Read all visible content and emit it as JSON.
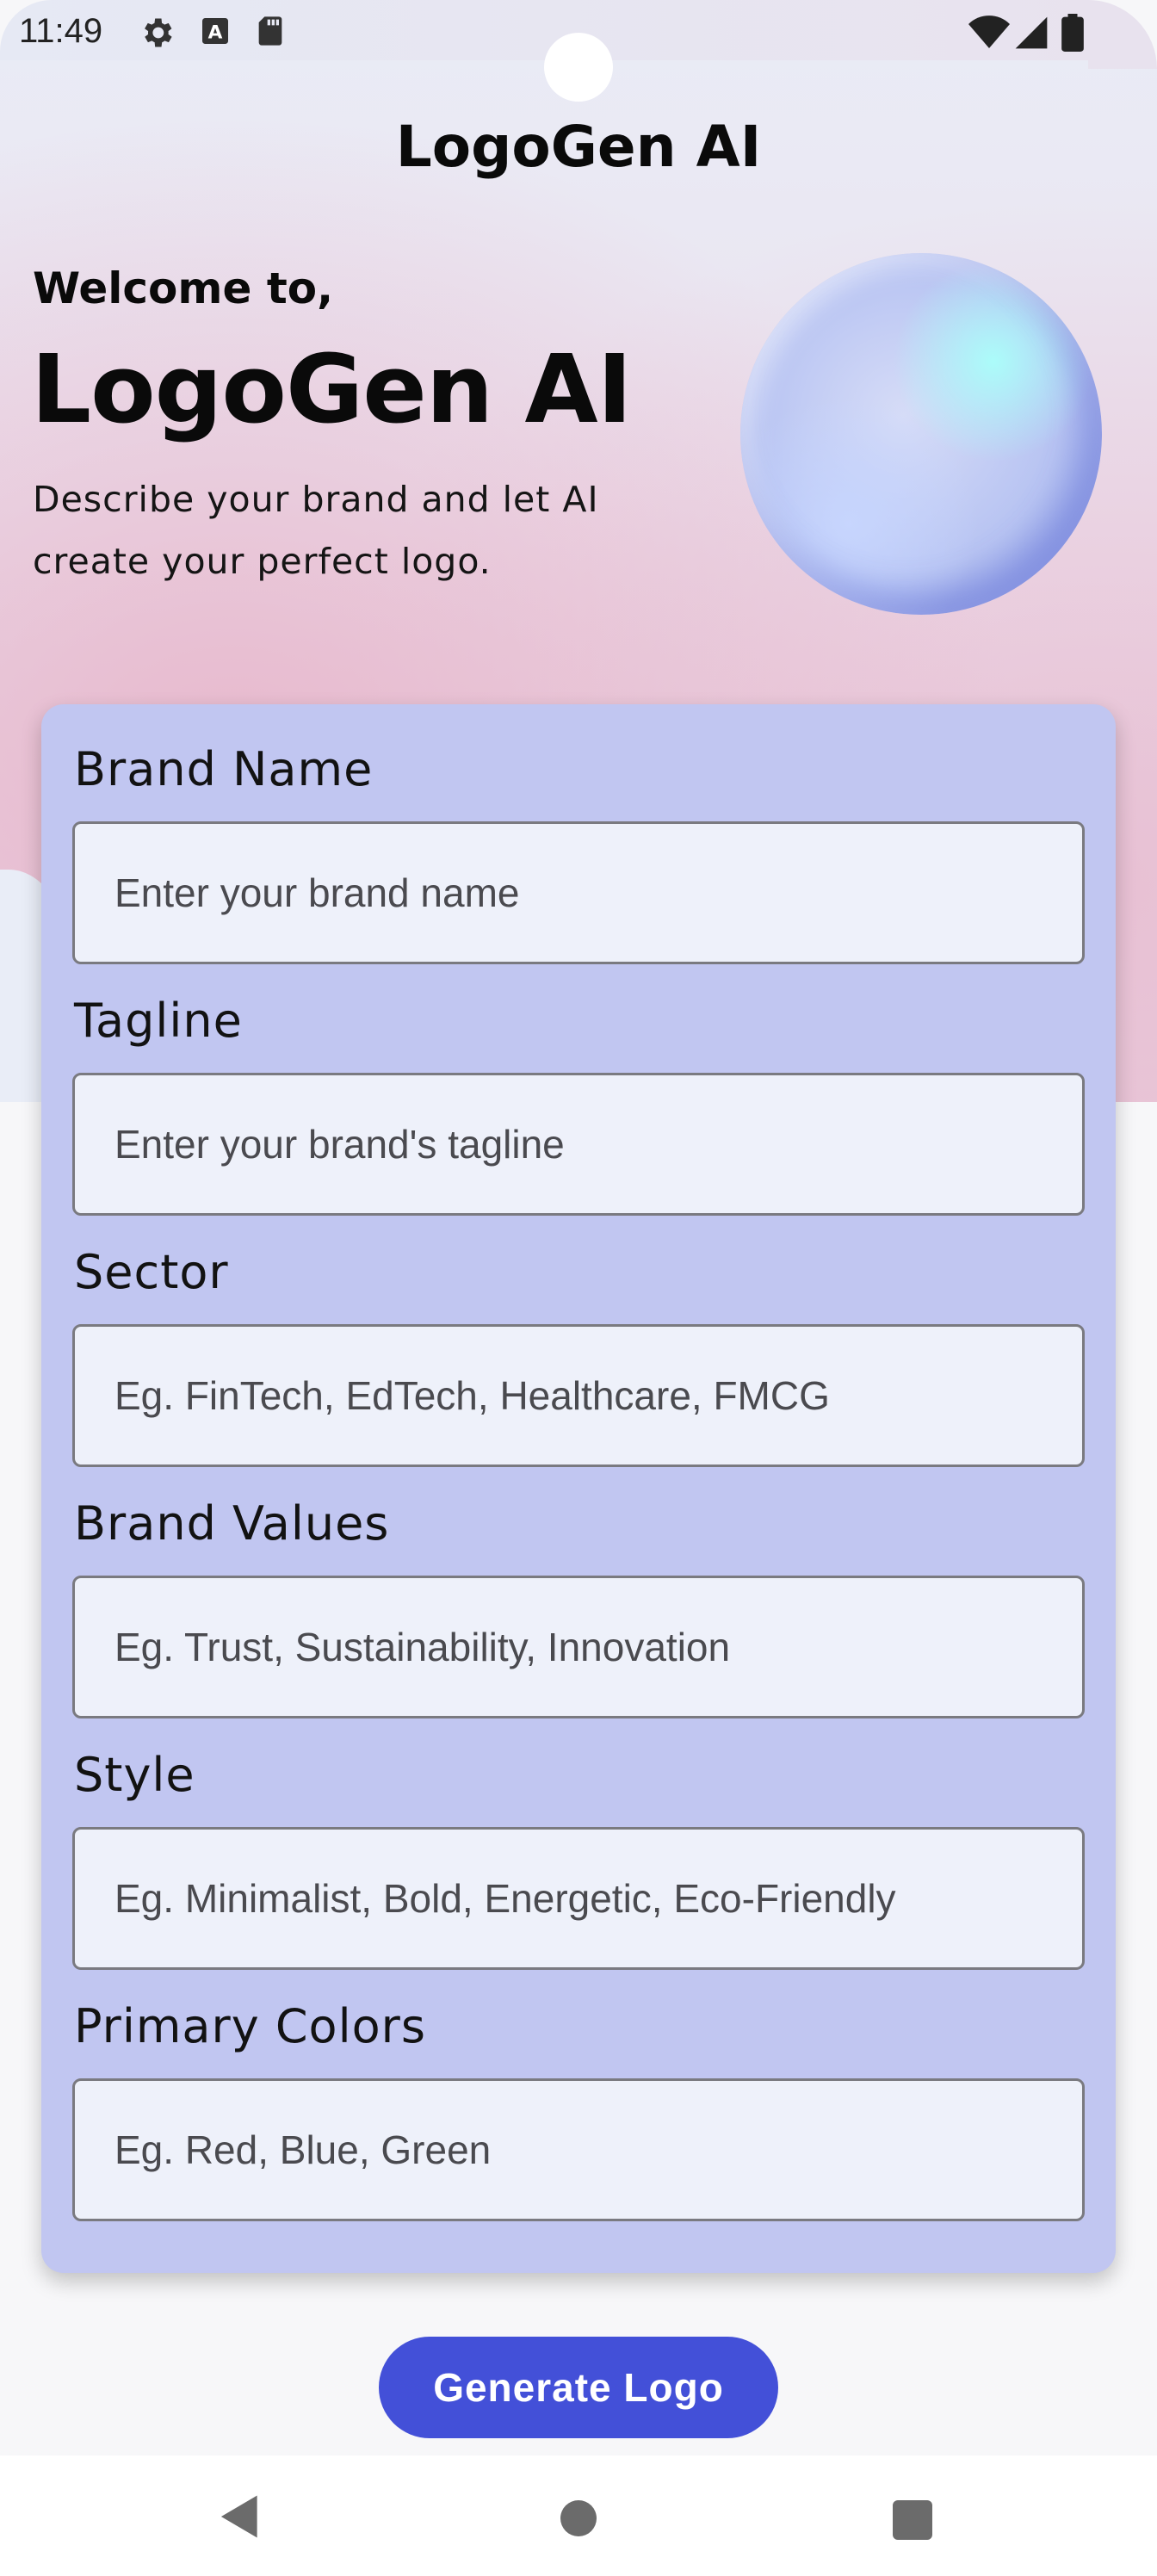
{
  "status_bar": {
    "time": "11:49",
    "icons": [
      "settings-icon",
      "keyboard-a-icon",
      "sd-card-icon",
      "wifi-icon",
      "signal-icon",
      "battery-icon"
    ]
  },
  "header": {
    "app_title": "LogoGen AI"
  },
  "hero": {
    "welcome": "Welcome to,",
    "title": "LogoGen AI",
    "description": "Describe your brand and let AI create your perfect logo."
  },
  "form": {
    "fields": [
      {
        "label": "Brand Name",
        "placeholder": "Enter your brand name",
        "value": ""
      },
      {
        "label": "Tagline",
        "placeholder": "Enter your brand's tagline",
        "value": ""
      },
      {
        "label": "Sector",
        "placeholder": "Eg. FinTech, EdTech, Healthcare, FMCG",
        "value": ""
      },
      {
        "label": "Brand Values",
        "placeholder": "Eg. Trust, Sustainability, Innovation",
        "value": ""
      },
      {
        "label": "Style",
        "placeholder": "Eg. Minimalist, Bold, Energetic, Eco-Friendly",
        "value": ""
      },
      {
        "label": "Primary Colors",
        "placeholder": "Eg. Red, Blue, Green",
        "value": ""
      }
    ]
  },
  "actions": {
    "generate_label": "Generate Logo"
  },
  "colors": {
    "card": "#c1c6f1",
    "input_bg": "#eef1fa",
    "button": "#4350d8"
  },
  "nav": {
    "icons": [
      "back-icon",
      "home-icon",
      "recents-icon"
    ]
  }
}
